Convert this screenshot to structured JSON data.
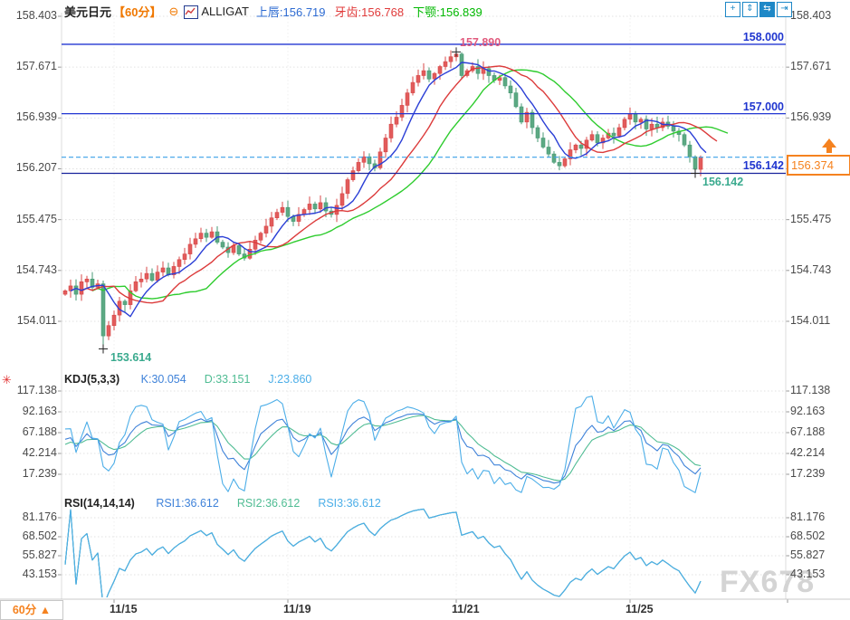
{
  "header": {
    "symbol": "美元日元",
    "period": "【60分】",
    "collapse_icon": "⊖",
    "indicator_name": "ALLIGAT",
    "legend": [
      {
        "label": "上唇",
        "value": "156.719",
        "color": "#2d6bd2"
      },
      {
        "label": "牙齿",
        "value": "156.768",
        "color": "#e03a3a"
      },
      {
        "label": "下颚",
        "value": "156.839",
        "color": "#00b800"
      }
    ],
    "toolbar": [
      {
        "name": "crosshair-icon",
        "glyph": "+",
        "active": false
      },
      {
        "name": "zoom-vertical-icon",
        "glyph": "⇕",
        "active": false
      },
      {
        "name": "zoom-horizontal-icon",
        "glyph": "⇆",
        "active": true
      },
      {
        "name": "exit-right-icon",
        "glyph": "⇥",
        "active": false
      }
    ]
  },
  "watermark": "FX678",
  "bottom_bar": {
    "period_label": "60分",
    "arrow": "▲"
  },
  "chart_data": [
    {
      "type": "candlestick",
      "title": "USD/JPY 60-minute",
      "y_axis_ticks": [
        "158.403",
        "157.671",
        "156.939",
        "156.207",
        "155.475",
        "154.743",
        "154.011"
      ],
      "x_axis_ticks": [
        {
          "label": "11/15",
          "candle": 9
        },
        {
          "label": "11/19",
          "candle": 41
        },
        {
          "label": "11/21",
          "candle": 72
        },
        {
          "label": "11/25",
          "candle": 104
        }
      ],
      "price_lines": [
        {
          "value": "158.000",
          "price": 158.0,
          "dark": false
        },
        {
          "value": "157.000",
          "price": 157.0,
          "dark": false
        },
        {
          "value": "156.142",
          "price": 156.142,
          "dark": true
        }
      ],
      "current_price": {
        "value": "156.374",
        "price": 156.374
      },
      "markers": [
        {
          "text": "157.890",
          "price": 157.89,
          "candle": 72,
          "pos": "above",
          "color": "#e15b7e"
        },
        {
          "text": "153.614",
          "price": 153.614,
          "candle": 7,
          "pos": "below",
          "color": "#3aaa8e"
        },
        {
          "text": "156.142",
          "price": 156.142,
          "candle": 116,
          "pos": "below",
          "color": "#3aaa8e"
        }
      ],
      "first_open": 154.4,
      "closes": [
        154.45,
        154.52,
        154.4,
        154.58,
        154.62,
        154.5,
        154.55,
        153.8,
        153.95,
        154.1,
        154.3,
        154.25,
        154.45,
        154.58,
        154.62,
        154.7,
        154.6,
        154.72,
        154.78,
        154.68,
        154.8,
        154.9,
        154.98,
        155.12,
        155.2,
        155.28,
        155.22,
        155.3,
        155.15,
        155.08,
        155.0,
        155.1,
        154.98,
        154.92,
        155.05,
        155.18,
        155.28,
        155.38,
        155.5,
        155.58,
        155.65,
        155.52,
        155.45,
        155.55,
        155.62,
        155.7,
        155.63,
        155.72,
        155.6,
        155.55,
        155.68,
        155.85,
        156.05,
        156.18,
        156.3,
        156.38,
        156.28,
        156.22,
        156.45,
        156.65,
        156.85,
        156.95,
        157.12,
        157.3,
        157.45,
        157.55,
        157.62,
        157.5,
        157.58,
        157.68,
        157.75,
        157.82,
        157.86,
        157.55,
        157.62,
        157.68,
        157.58,
        157.65,
        157.55,
        157.48,
        157.52,
        157.4,
        157.3,
        157.1,
        156.88,
        157.02,
        156.8,
        156.65,
        156.52,
        156.42,
        156.3,
        156.25,
        156.35,
        156.48,
        156.55,
        156.5,
        156.62,
        156.7,
        156.58,
        156.65,
        156.72,
        156.68,
        156.8,
        156.92,
        157.0,
        156.88,
        156.92,
        156.78,
        156.85,
        156.8,
        156.88,
        156.82,
        156.75,
        156.7,
        156.55,
        156.38,
        156.2,
        156.374
      ],
      "special_candles": {
        "7": {
          "low": 153.614
        },
        "72": {
          "high": 157.89
        },
        "116": {
          "low": 156.142
        }
      },
      "alligator": {
        "upper_lip": 156.719,
        "teeth": 156.768,
        "jaw": 156.839,
        "colors": {
          "upper_lip": "#2b3fd6",
          "teeth": "#dc3b3b",
          "jaw": "#2ecc2e"
        }
      }
    },
    {
      "type": "line",
      "name": "KDJ",
      "params": "(5,3,3)",
      "legend": [
        {
          "label": "K",
          "value": "30.054",
          "color": "#3f82d9"
        },
        {
          "label": "D",
          "value": "33.151",
          "color": "#4fbc93"
        },
        {
          "label": "J",
          "value": "23.860",
          "color": "#4caee8"
        }
      ],
      "y_axis_ticks": [
        "117.138",
        "92.163",
        "67.188",
        "42.214",
        "17.239"
      ]
    },
    {
      "type": "line",
      "name": "RSI",
      "params": "(14,14,14)",
      "legend": [
        {
          "label": "RSI1",
          "value": "36.612",
          "color": "#3f82d9"
        },
        {
          "label": "RSI2",
          "value": "36.612",
          "color": "#4fbc93"
        },
        {
          "label": "RSI3",
          "value": "36.612",
          "color": "#4caee8"
        }
      ],
      "y_axis_ticks": [
        "81.176",
        "68.502",
        "55.827",
        "43.153"
      ]
    }
  ]
}
